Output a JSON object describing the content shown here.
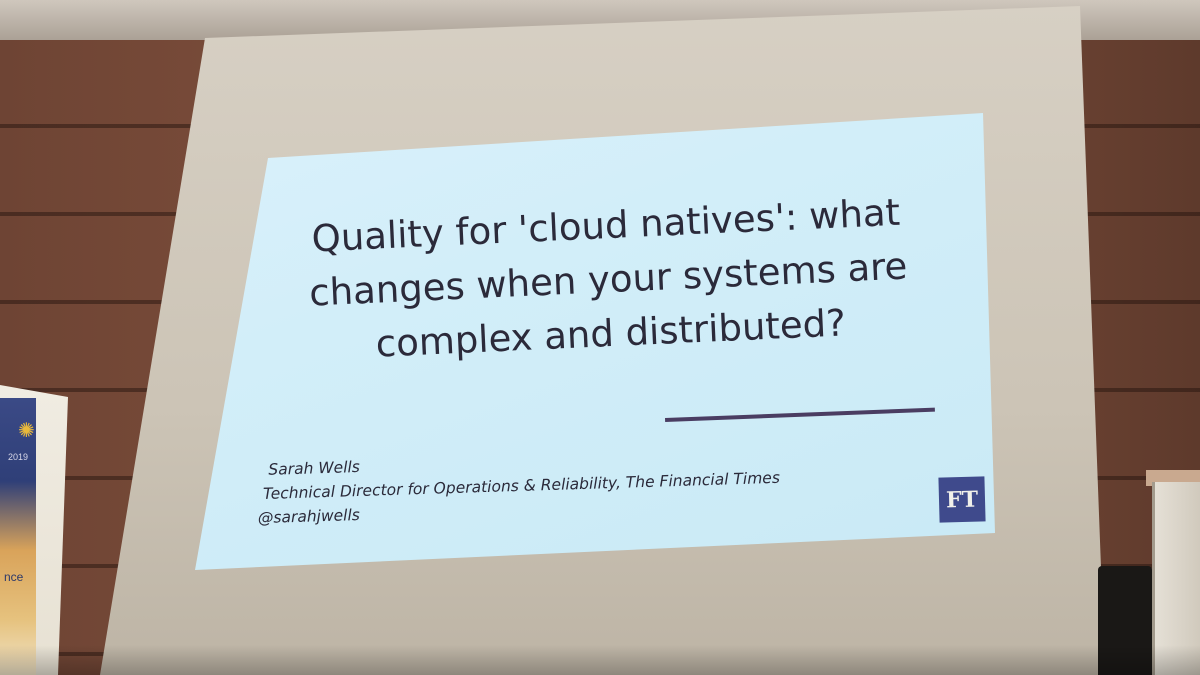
{
  "slide": {
    "title_lines": [
      "Quality for 'cloud natives': what",
      "changes when your systems are",
      "complex and distributed?"
    ],
    "speaker_name": "Sarah Wells",
    "speaker_role": "Technical Director for Operations & Reliability, The Financial Times",
    "speaker_handle": "@sarahjwells",
    "logo_text": "FT"
  },
  "banner": {
    "year_fragment": "2019",
    "word_fragment": "nce"
  },
  "colors": {
    "slide_background": "#d2eef9",
    "slide_text": "#2b2a3a",
    "divider": "#4a3d62",
    "ft_logo_bg": "#3f4a8c",
    "wall_wood": "#7a4b38"
  }
}
